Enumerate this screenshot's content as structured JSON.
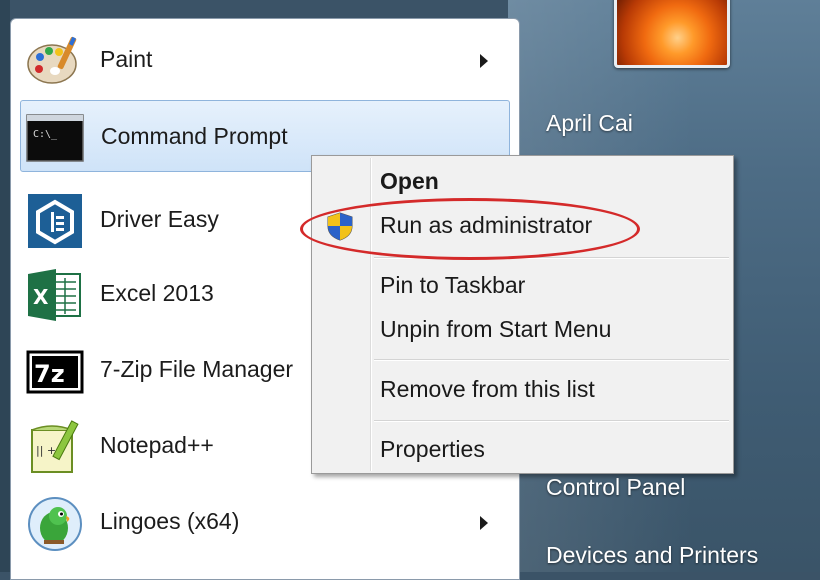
{
  "start_menu": {
    "programs": [
      {
        "label": "Paint",
        "icon": "paint-palette-icon",
        "has_submenu": true
      },
      {
        "label": "Command Prompt",
        "icon": "command-prompt-icon",
        "has_submenu": false,
        "selected": true
      },
      {
        "label": "Driver Easy",
        "icon": "driver-easy-icon",
        "has_submenu": false
      },
      {
        "label": "Excel 2013",
        "icon": "excel-icon",
        "has_submenu": false
      },
      {
        "label": "7-Zip File Manager",
        "icon": "seven-zip-icon",
        "has_submenu": false
      },
      {
        "label": "Notepad++",
        "icon": "notepad-plus-plus-icon",
        "has_submenu": false
      },
      {
        "label": "Lingoes (x64)",
        "icon": "lingoes-parrot-icon",
        "has_submenu": true
      }
    ],
    "icon_text": {
      "cmd": "C:\\_",
      "excel": "X",
      "seven_zip": "7z",
      "notepad": "|| +"
    },
    "right_pane": {
      "user_name": "April Cai",
      "items": [
        "Control Panel",
        "Devices and Printers"
      ]
    }
  },
  "context_menu": {
    "items": [
      {
        "label": "Open",
        "bold": true
      },
      {
        "label": "Run as administrator",
        "icon": "uac-shield-icon",
        "highlighted": true
      },
      {
        "label": "Pin to Taskbar"
      },
      {
        "label": "Unpin from Start Menu"
      },
      {
        "label": "Remove from this list"
      },
      {
        "label": "Properties"
      }
    ]
  },
  "colors": {
    "highlight_ring": "#d42a2a",
    "selection_bg": "#cfe3f8",
    "right_pane": "#4d6c85"
  }
}
